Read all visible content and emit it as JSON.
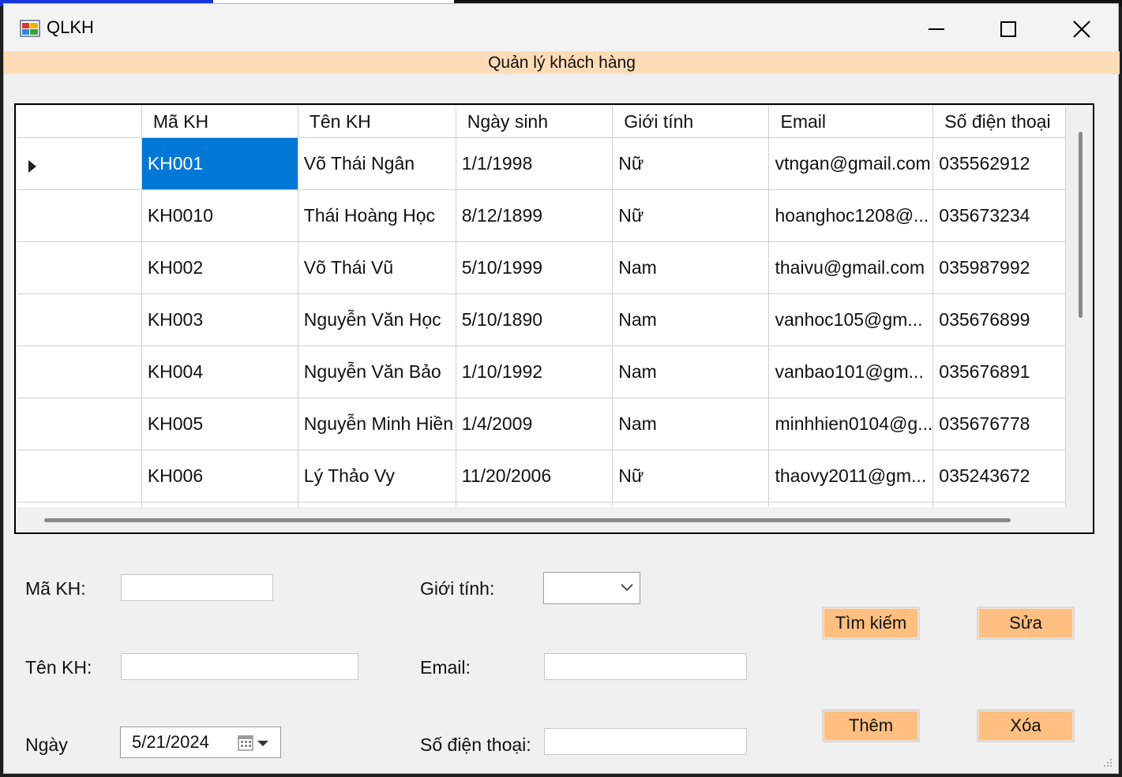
{
  "window": {
    "title": "QLKH"
  },
  "banner": {
    "text": "Quản lý khách hàng"
  },
  "grid": {
    "columns": [
      "",
      "Mã KH",
      "Tên KH",
      "Ngày sinh",
      "Giới tính",
      "Email",
      "Số điện thoại"
    ],
    "rows": [
      {
        "ma": "KH001",
        "ten": "Võ Thái Ngân",
        "ngay": "1/1/1998",
        "gioitinh": "Nữ",
        "email": "vtngan@gmail.com",
        "sdt": "035562912"
      },
      {
        "ma": "KH0010",
        "ten": "Thái Hoàng Học",
        "ngay": "8/12/1899",
        "gioitinh": "Nữ",
        "email": "hoanghoc1208@...",
        "sdt": "035673234"
      },
      {
        "ma": "KH002",
        "ten": "Võ Thái Vũ",
        "ngay": "5/10/1999",
        "gioitinh": "Nam",
        "email": "thaivu@gmail.com",
        "sdt": "035987992"
      },
      {
        "ma": "KH003",
        "ten": "Nguyễn Văn Học",
        "ngay": "5/10/1890",
        "gioitinh": "Nam",
        "email": "vanhoc105@gm...",
        "sdt": "035676899"
      },
      {
        "ma": "KH004",
        "ten": "Nguyễn Văn Bảo",
        "ngay": "1/10/1992",
        "gioitinh": "Nam",
        "email": "vanbao101@gm...",
        "sdt": "035676891"
      },
      {
        "ma": "KH005",
        "ten": "Nguyễn Minh Hiền",
        "ngay": "1/4/2009",
        "gioitinh": "Nam",
        "email": "minhhien0104@g...",
        "sdt": "035676778"
      },
      {
        "ma": "KH006",
        "ten": "Lý Thảo Vy",
        "ngay": "11/20/2006",
        "gioitinh": "Nữ",
        "email": "thaovy2011@gm...",
        "sdt": "035243672"
      },
      {
        "ma": "",
        "ten": "",
        "ngay": "",
        "gioitinh": "",
        "email": "",
        "sdt": ""
      }
    ]
  },
  "form": {
    "ma_label": "Mã KH:",
    "ma_value": "",
    "ten_label": "Tên KH:",
    "ten_value": "",
    "ngay_label": "Ngày",
    "ngay_value": "5/21/2024",
    "gioitinh_label": "Giới tính:",
    "gioitinh_value": "",
    "email_label": "Email:",
    "email_value": "",
    "sdt_label": "Số điện thoại:",
    "sdt_value": ""
  },
  "buttons": {
    "timkiem": "Tìm kiếm",
    "sua": "Sửa",
    "them": "Thêm",
    "xoa": "Xóa"
  },
  "colors": {
    "banner_bg": "#ffdcb8",
    "button_bg": "#ffbf80",
    "selection": "#0078d7"
  }
}
